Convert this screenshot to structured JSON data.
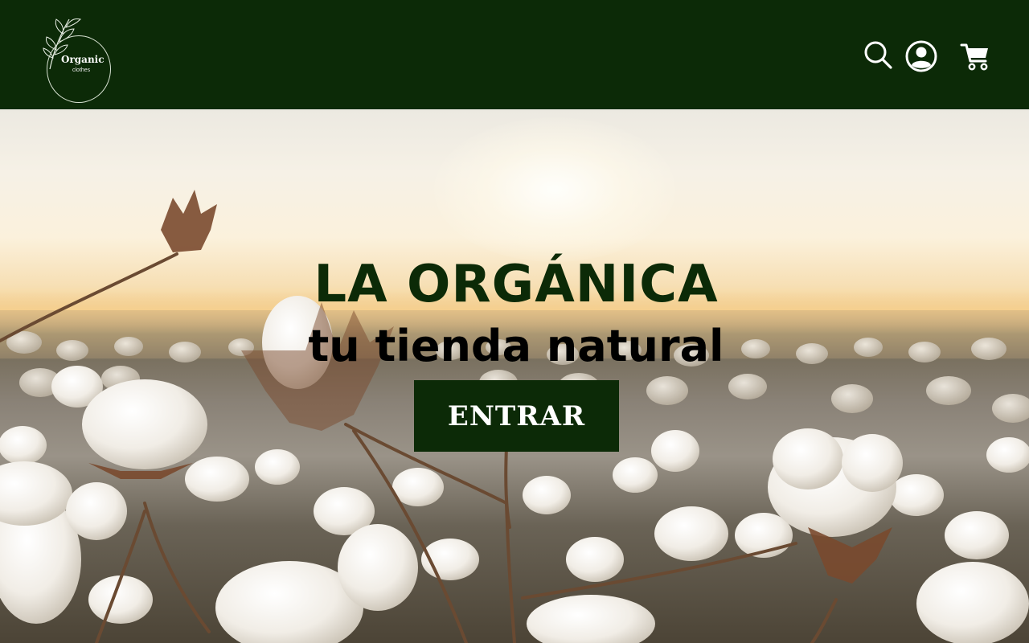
{
  "header": {
    "background": "#0c2a07",
    "logo": {
      "brand": "Organic",
      "sub": "clothes",
      "icon": "leaf-branch-icon"
    },
    "icons": [
      {
        "name": "search-icon"
      },
      {
        "name": "user-account-icon"
      },
      {
        "name": "shopping-cart-icon"
      }
    ]
  },
  "hero": {
    "title": "LA ORGÁNICA",
    "subtitle": "tu tienda natural",
    "button_label": "ENTRAR",
    "background": "cotton-field-sunset-photo",
    "accent": "#0c2a07"
  }
}
